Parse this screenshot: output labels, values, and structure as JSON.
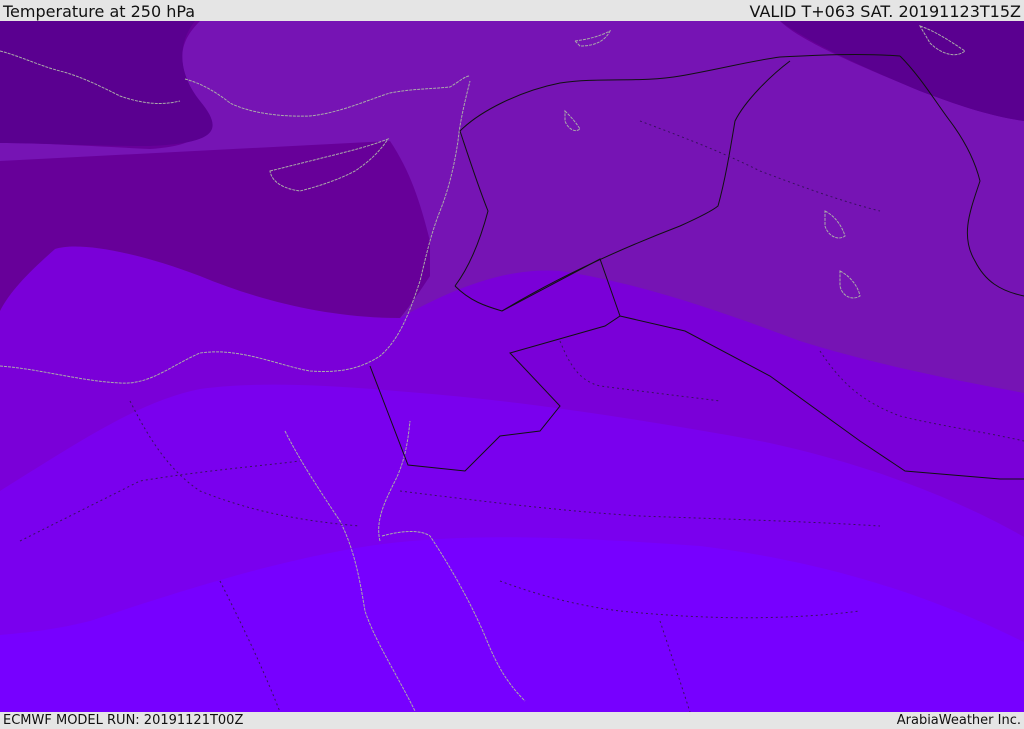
{
  "header": {
    "title": "Temperature at 250 hPa",
    "valid_time": "VALID T+063 SAT. 20191123T15Z"
  },
  "footer": {
    "model_run": "ECMWF MODEL RUN: 20191121T00Z",
    "credit": "ArabiaWeather Inc."
  },
  "map": {
    "field": "temperature",
    "level_hpa": 250,
    "band_colors": [
      "#5a0090",
      "#670099",
      "#7614b4",
      "#7a00d8",
      "#7a00ee",
      "#7700ff"
    ],
    "coastline_color": "#aaaaaa",
    "border_color": "#000000"
  }
}
